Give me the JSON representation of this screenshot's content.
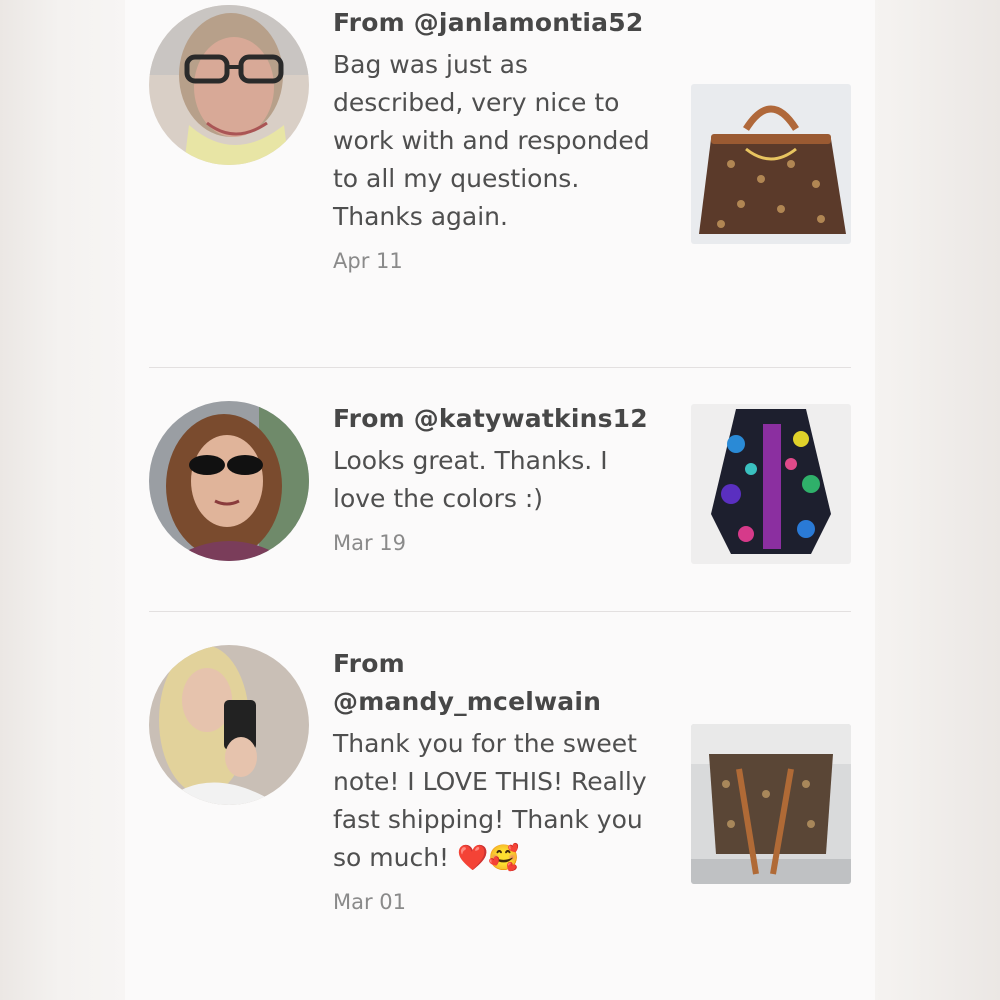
{
  "reviews": [
    {
      "from": "From @janlamontia52",
      "message": "Bag was just as described, very nice to work with and responded to all my questions. Thanks again.",
      "date": "Apr 11",
      "avatar_icon": "user-avatar",
      "item_icon": "handbag-photo"
    },
    {
      "from": "From @katywatkins12",
      "message": "Looks great. Thanks. I love the colors :)",
      "date": "Mar 19",
      "avatar_icon": "user-avatar",
      "item_icon": "jacket-photo"
    },
    {
      "from": "From @mandy_mcelwain",
      "message": "Thank you for the sweet note! I LOVE THIS! Really fast shipping! Thank you so much!",
      "emoji": "❤️🥰",
      "date": "Mar 01",
      "avatar_icon": "user-avatar",
      "item_icon": "tote-bag-photo"
    }
  ],
  "colors": {
    "text": "#4b4b4b",
    "date": "#8a8a8a",
    "divider": "#e3e0e0",
    "panel": "#fbfafa"
  }
}
